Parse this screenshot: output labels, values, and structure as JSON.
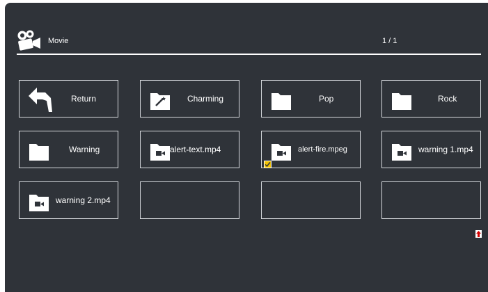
{
  "header": {
    "title": "Movie",
    "page_counter": "1 / 1",
    "icon": "movie-camera-icon"
  },
  "tiles": [
    {
      "label": "Return",
      "icon": "return-arrow-icon"
    },
    {
      "label": "Charming",
      "icon": "folder-magic-wand-icon"
    },
    {
      "label": "Pop",
      "icon": "folder-icon"
    },
    {
      "label": "Rock",
      "icon": "folder-icon"
    },
    {
      "label": "Warning",
      "icon": "folder-icon"
    },
    {
      "label": "alert-text.mp4",
      "icon": "video-file-icon"
    },
    {
      "label": "alert-fire.mpeg",
      "icon": "video-file-icon",
      "checked": true
    },
    {
      "label": "warning 1.mp4",
      "icon": "video-file-icon"
    },
    {
      "label": "warning 2.mp4",
      "icon": "video-file-icon"
    },
    {
      "label": "",
      "icon": ""
    },
    {
      "label": "",
      "icon": ""
    },
    {
      "label": "",
      "icon": ""
    }
  ],
  "colors": {
    "background": "#2f3339",
    "border": "#d9dce0",
    "text": "#ffffff",
    "check": "#f2c200",
    "scroll_arrow": "#d40000"
  }
}
